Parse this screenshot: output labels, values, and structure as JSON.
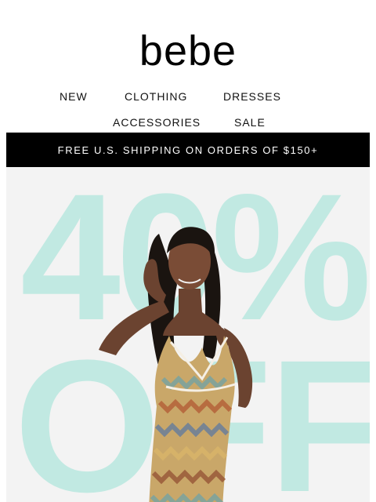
{
  "brand": {
    "logo_text": "bebe"
  },
  "nav": {
    "row1": [
      "NEW",
      "CLOTHING",
      "DRESSES"
    ],
    "row2": [
      "ACCESSORIES",
      "SALE"
    ]
  },
  "promo": {
    "text": "FREE U.S. SHIPPING ON ORDERS OF $150+"
  },
  "hero": {
    "line1": "40%",
    "line2": "OFF",
    "accent_color": "#c1e9e2",
    "background_color": "#f3f3f3"
  }
}
